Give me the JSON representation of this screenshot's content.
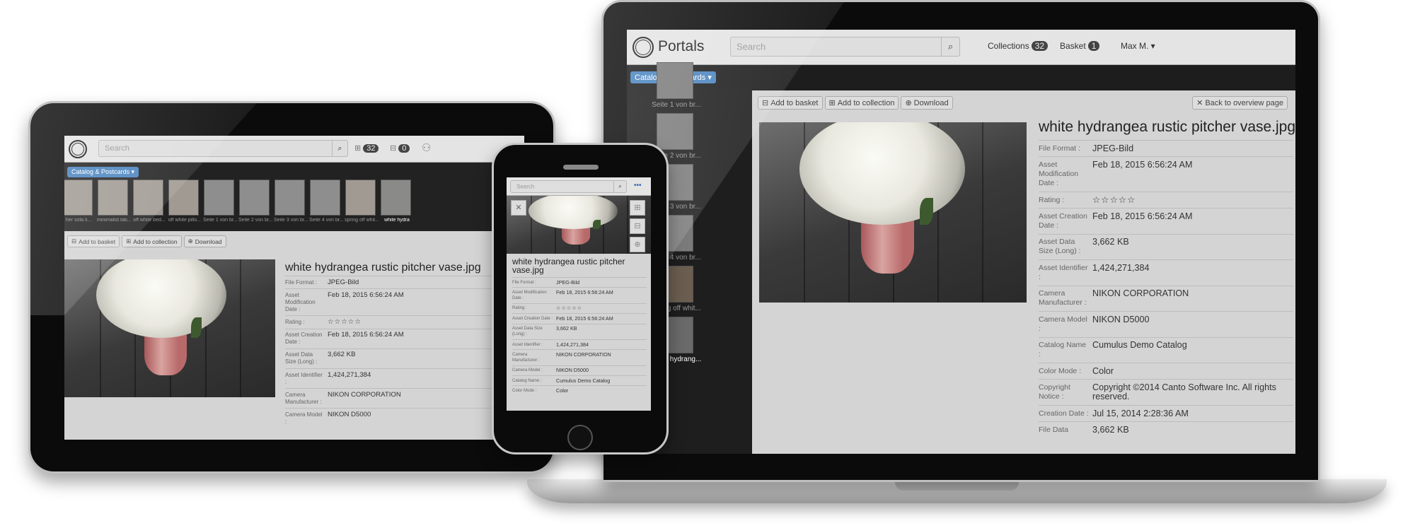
{
  "app": {
    "name": "Portals",
    "search_placeholder": "Search",
    "catalog_button": "Catalog & Postcards ▾"
  },
  "laptop": {
    "collections_label": "Collections",
    "collections_count": "32",
    "basket_label": "Basket",
    "basket_count": "1",
    "user_menu": "Max M. ▾",
    "add_to_basket": "Add to basket",
    "add_to_collection": "Add to collection",
    "download": "Download",
    "back_to_overview": "Back to overview page",
    "sidebar_thumbs": [
      "Seite 1 von br...",
      "Seite 2 von br...",
      "Seite 3 von br...",
      "Seite 4 von br...",
      "spring off whit...",
      "white hydrang..."
    ]
  },
  "tablet": {
    "collections_count": "32",
    "basket_count": "0",
    "thumbs": [
      "her sofa li...",
      "minimalist tab...",
      "off white bed...",
      "off white pillo...",
      "Seite 1 von br...",
      "Seite 2 von br...",
      "Seite 3 von br...",
      "Seite 4 von br...",
      "spring off whit...",
      "white hydra"
    ],
    "add_to_basket": "Add to basket",
    "add_to_collection": "Add to collection",
    "download": "Download"
  },
  "phone": {
    "menu_icon": "•••"
  },
  "asset": {
    "title": "white hydrangea rustic pitcher vase.jpg",
    "rating": 0,
    "rating_display": "☆☆☆☆☆",
    "fields": [
      {
        "label": "File Format :",
        "value": "JPEG-Bild"
      },
      {
        "label": "Asset Modification Date :",
        "value": "Feb 18, 2015 6:56:24 AM"
      },
      {
        "label": "Rating :",
        "value": "☆☆☆☆☆"
      },
      {
        "label": "Asset Creation Date :",
        "value": "Feb 18, 2015 6:56:24 AM"
      },
      {
        "label": "Asset Data Size (Long) :",
        "value": "3,662 KB"
      },
      {
        "label": "Asset Identifier :",
        "value": "1,424,271,384"
      },
      {
        "label": "Camera Manufacturer :",
        "value": "NIKON CORPORATION"
      },
      {
        "label": "Camera Model :",
        "value": "NIKON D5000"
      },
      {
        "label": "Catalog Name :",
        "value": "Cumulus Demo Catalog"
      },
      {
        "label": "Color Mode :",
        "value": "Color"
      },
      {
        "label": "Copyright Notice :",
        "value": "Copyright ©2014 Canto Software Inc. All rights reserved."
      },
      {
        "label": "Creation Date :",
        "value": "Jul 15, 2014 2:28:36 AM"
      },
      {
        "label": "File Data",
        "value": "3,662 KB"
      }
    ]
  },
  "colors": {
    "accent": "#4a84c0",
    "panel": "#d4d4d4",
    "header": "#e4e4e4",
    "nav": "#1d1d1d"
  }
}
